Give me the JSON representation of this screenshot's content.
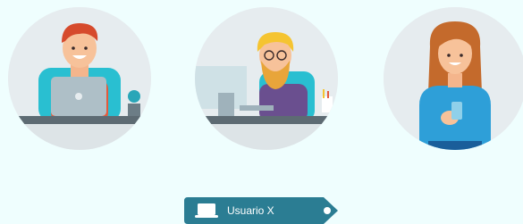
{
  "avatars": [
    {
      "icon": "man-with-laptop-avatar-icon"
    },
    {
      "icon": "bearded-man-at-desk-avatar-icon"
    },
    {
      "icon": "woman-with-phone-avatar-icon"
    }
  ],
  "user_tag": {
    "label": "Usuario X",
    "icon": "laptop-icon",
    "color": "#2b7d93"
  },
  "colors": {
    "background": "#effefe",
    "avatar_bg": "#e6ecef",
    "accent": "#2b7d93"
  }
}
